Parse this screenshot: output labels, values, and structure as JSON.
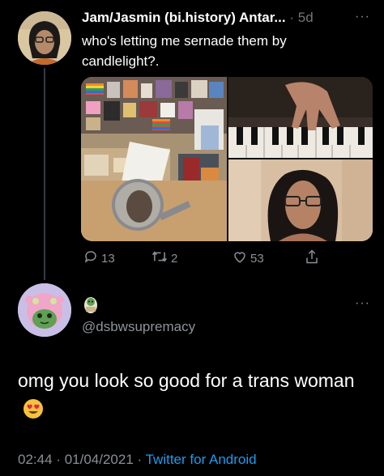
{
  "tweet": {
    "author_name": "Jam/Jasmin (bi.history) Antar...",
    "separator": "·",
    "age": "5d",
    "more": "···",
    "text": "who's letting me sernade them by candlelight?.",
    "actions": {
      "replies": "13",
      "retweets": "2",
      "likes": "53"
    },
    "icons": [
      "reply-icon",
      "retweet-icon",
      "heart-icon",
      "share-icon"
    ]
  },
  "reply": {
    "handle": "@dsbwsupremacy",
    "more": "···",
    "text": "omg you look so good for a trans woman",
    "emoji": "heart-eyes-emoji",
    "time": "02:44",
    "sep1": "·",
    "date": "01/04/2021",
    "sep2": "·",
    "source": "Twitter for Android"
  },
  "colors": {
    "background": "#000000",
    "muted": "#71767b",
    "link": "#1d9bf0"
  }
}
